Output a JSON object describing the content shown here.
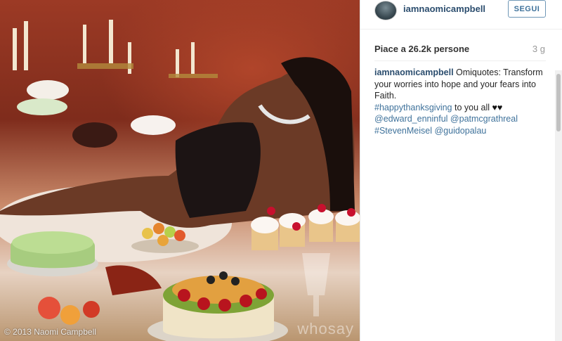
{
  "photo": {
    "copyright": "© 2013 Naomi Campbell",
    "watermark": "whosay"
  },
  "header": {
    "username": "iamnaomicampbell",
    "follow_label": "SEGUI"
  },
  "stats": {
    "likes": "Piace a 26.2k persone",
    "time": "3 g"
  },
  "caption": {
    "user": "iamnaomicampbell",
    "line1": " Omiquotes: Transform your worries into hope and your fears into Faith.",
    "hashtag1": "#happythanksgiving",
    "text2": " to you all ",
    "hearts": "♥♥",
    "mention1": "@edward_enninful",
    "mention2": "@patmcgrathreal",
    "hashtag2": "#StevenMeisel",
    "mention3": "@guidopalau"
  },
  "colors": {
    "link": "#3f729b",
    "username": "#2b4d6e"
  }
}
